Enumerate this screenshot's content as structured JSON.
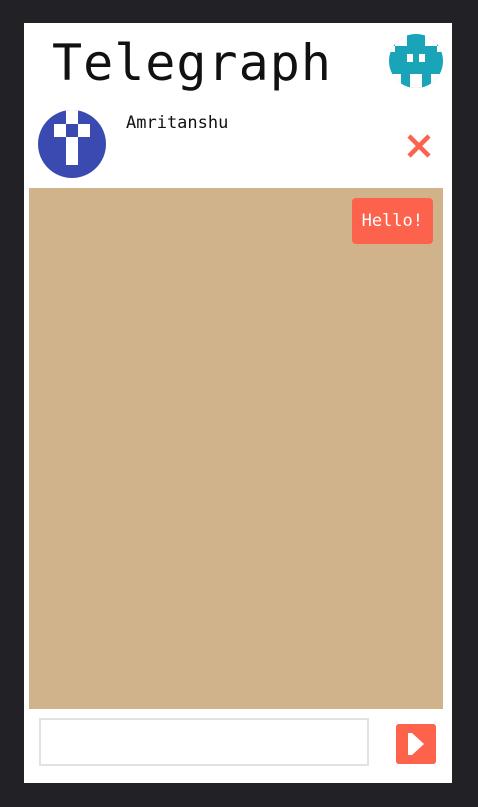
{
  "app": {
    "title": "Telegraph",
    "current_user_avatar_icon": "identicon-avatar-icon",
    "current_user_avatar_color": "#1aa4b8"
  },
  "chat": {
    "contact": {
      "name": "Amritanshu",
      "avatar_icon": "identicon-avatar-icon",
      "avatar_color": "#3b4ab0"
    },
    "close_icon": "close-icon",
    "background_color": "#d1b38b",
    "messages": [
      {
        "text": "Hello!",
        "direction": "outgoing",
        "bubble_color": "#fd624c"
      }
    ]
  },
  "composer": {
    "input_value": "",
    "input_placeholder": "",
    "send_icon": "send-icon",
    "accent_color": "#fd624c"
  }
}
